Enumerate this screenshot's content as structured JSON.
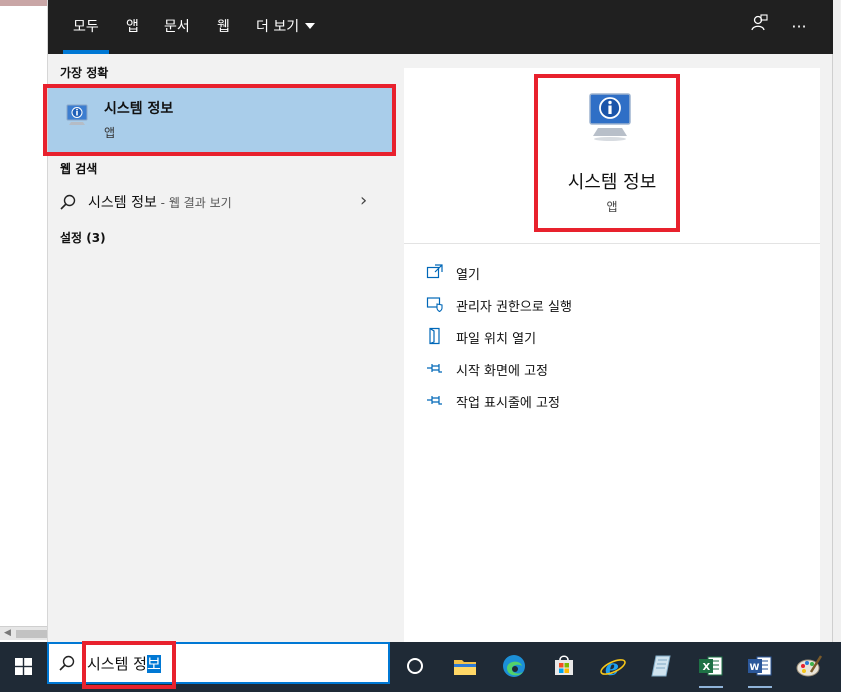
{
  "header": {
    "tabs": [
      {
        "label": "모두",
        "active": true
      },
      {
        "label": "앱"
      },
      {
        "label": "문서"
      },
      {
        "label": "웹"
      },
      {
        "label": "더 보기"
      }
    ],
    "feedback_icon": "feedback-person-icon",
    "more_icon": "ellipsis-icon"
  },
  "left": {
    "best_match_title": "가장 정확",
    "best_match": {
      "name": "시스템 정보",
      "type": "앱",
      "icon": "system-info-icon"
    },
    "web_search_title": "웹 검색",
    "web_search": {
      "query": "시스템 정보",
      "suffix": " - 웹 결과 보기"
    },
    "settings_title": "설정 (3)"
  },
  "preview": {
    "name": "시스템 정보",
    "type": "앱",
    "actions": [
      {
        "label": "열기",
        "icon": "open-icon"
      },
      {
        "label": "관리자 권한으로 실행",
        "icon": "run-as-admin-icon"
      },
      {
        "label": "파일 위치 열기",
        "icon": "file-location-icon"
      },
      {
        "label": "시작 화면에 고정",
        "icon": "pin-icon"
      },
      {
        "label": "작업 표시줄에 고정",
        "icon": "pin-icon"
      }
    ]
  },
  "taskbar": {
    "search_text_before": "시스템 정",
    "search_text_selected": "보",
    "apps": [
      "task-view-icon",
      "file-explorer-icon",
      "edge-icon",
      "store-icon",
      "ie-icon",
      "notepad-icon",
      "excel-icon",
      "word-icon",
      "paint-icon"
    ]
  },
  "colors": {
    "accent": "#0078d4",
    "highlight": "#a9cdea",
    "callout": "#e8212d",
    "taskbar": "#1f2a36"
  }
}
